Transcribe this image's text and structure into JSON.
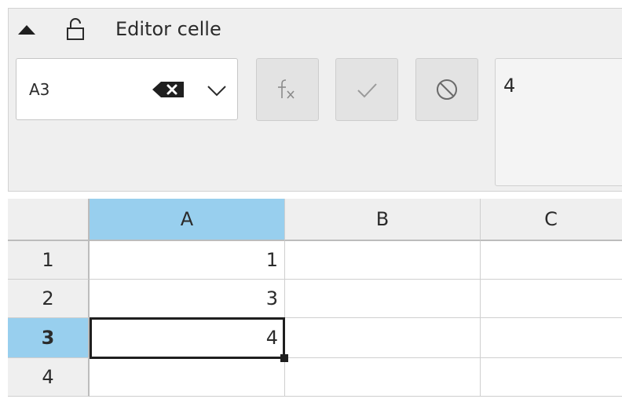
{
  "editor": {
    "title": "Editor celle",
    "cell_reference": "A3",
    "formula_content": "4",
    "icons": {
      "collapse": "triangle-up-icon",
      "lock": "lock-icon",
      "clear": "backspace-icon",
      "dropdown": "chevron-down-icon",
      "function": "fx-icon",
      "accept": "checkmark-icon",
      "cancel": "cancel-circle-icon"
    }
  },
  "sheet": {
    "columns": [
      "A",
      "B",
      "C"
    ],
    "rows": [
      "1",
      "2",
      "3",
      "4"
    ],
    "cells": [
      [
        "1",
        "",
        ""
      ],
      [
        "3",
        "",
        ""
      ],
      [
        "4",
        "",
        ""
      ],
      [
        "",
        "",
        ""
      ]
    ],
    "selected_cell": "A3",
    "selection_color": "#98cfee"
  }
}
